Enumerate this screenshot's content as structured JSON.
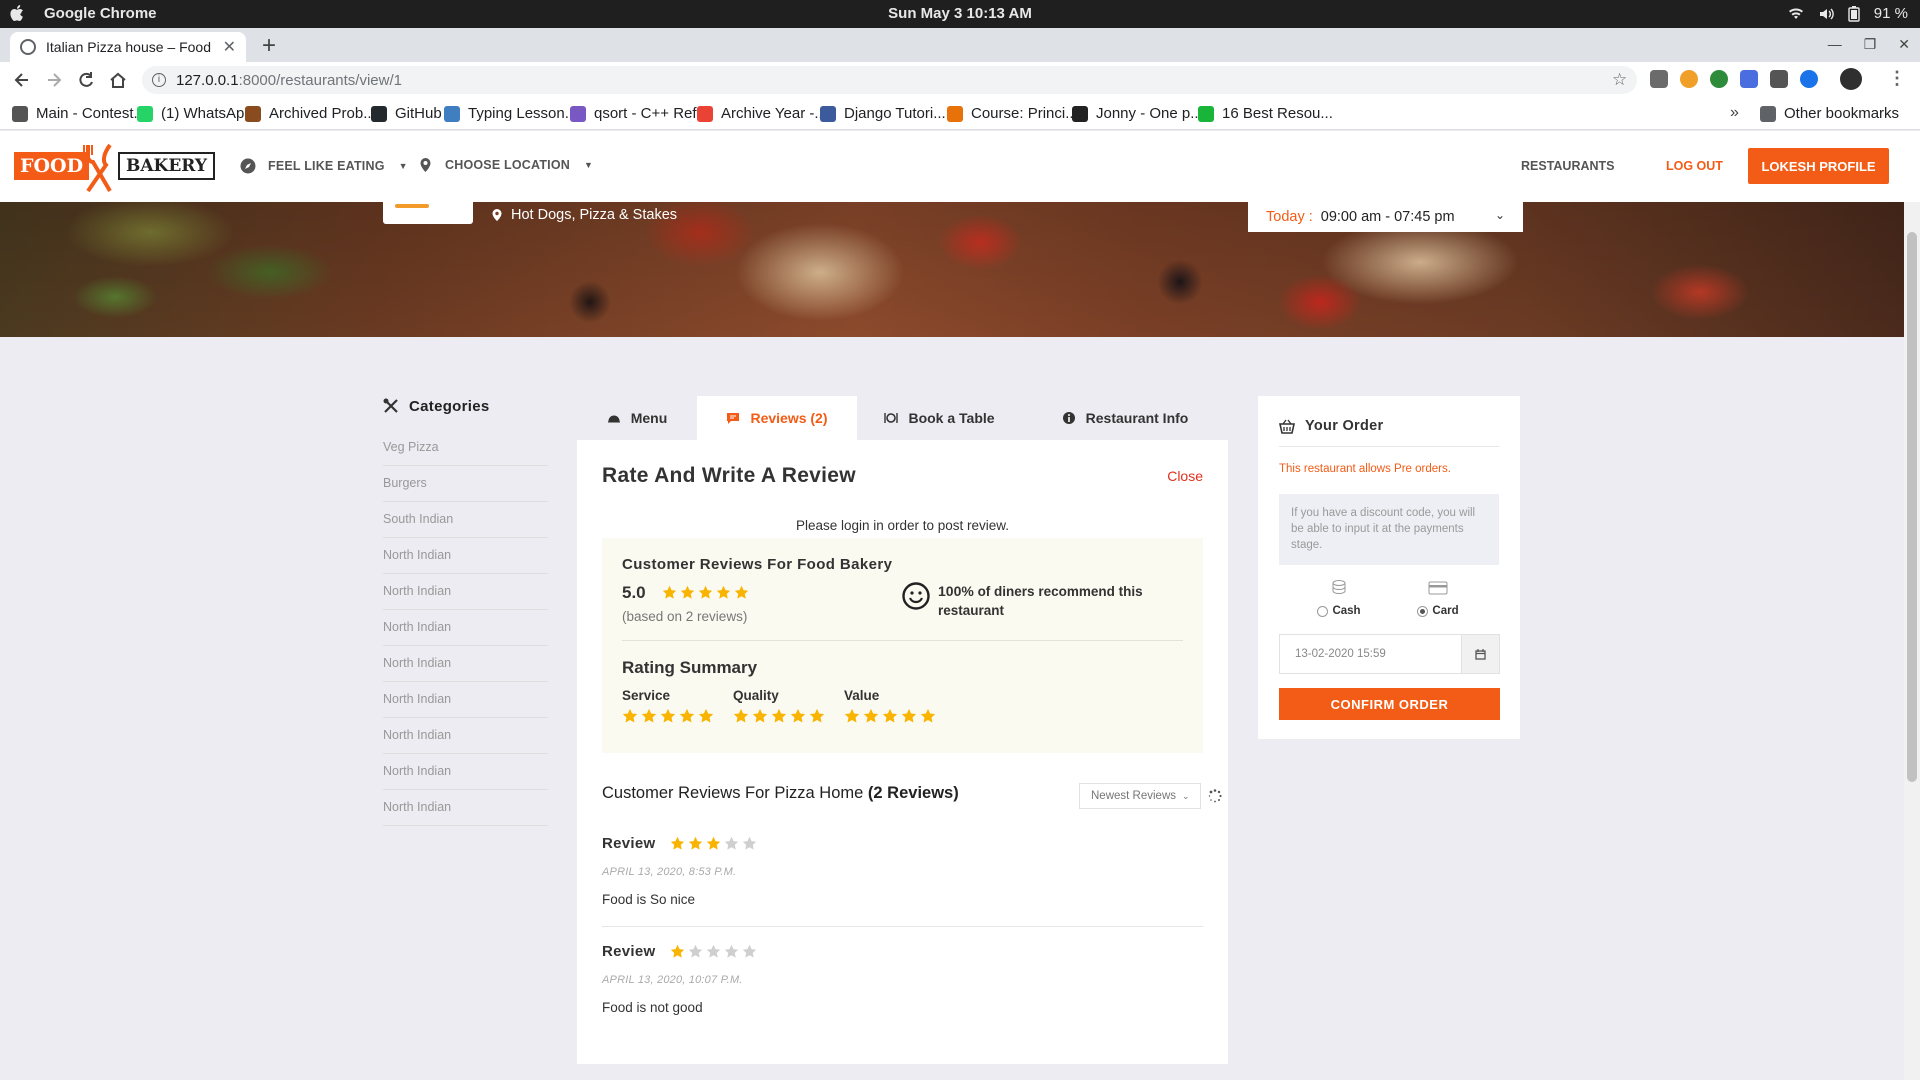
{
  "os": {
    "app_name": "Google Chrome",
    "clock": "Sun May 3  10:13 AM",
    "battery": "91 %"
  },
  "browser": {
    "tab_title": "Italian Pizza house – Food",
    "url_host": "127.0.0.1",
    "url_path": ":8000/restaurants/view/1",
    "bookmarks": [
      {
        "label": "Main - Contest...",
        "color": "#555555"
      },
      {
        "label": "(1) WhatsApp",
        "color": "#25d366"
      },
      {
        "label": "Archived Prob...",
        "color": "#8a4b1f"
      },
      {
        "label": "GitHub",
        "color": "#24292e"
      },
      {
        "label": "Typing Lesson...",
        "color": "#3f7fbf"
      },
      {
        "label": "qsort - C++ Ref...",
        "color": "#7a58c4"
      },
      {
        "label": "Archive Year -...",
        "color": "#ea4335"
      },
      {
        "label": "Django Tutori...",
        "color": "#3b5b9d"
      },
      {
        "label": "Course: Princi...",
        "color": "#e8710a"
      },
      {
        "label": "Jonny - One p...",
        "color": "#222222"
      },
      {
        "label": "16 Best Resou...",
        "color": "#18b53a"
      }
    ],
    "other_bookmarks": "Other bookmarks"
  },
  "header": {
    "logo_food": "FOOD",
    "logo_bakery": "BAKERY",
    "nav_eating": "FEEL LIKE EATING",
    "nav_location": "CHOOSE LOCATION",
    "link_restaurants": "RESTAURANTS",
    "link_logout": "LOG OUT",
    "profile_button": "LOKESH PROFILE",
    "brand_color": "#f25c16"
  },
  "hero": {
    "cuisines": "Hot Dogs, Pizza & Stakes",
    "hours_label": "Today :",
    "hours_value": "09:00 am - 07:45 pm"
  },
  "categories": {
    "title": "Categories",
    "items": [
      "Veg Pizza",
      "Burgers",
      "South Indian",
      "North Indian",
      "North Indian",
      "North Indian",
      "North Indian",
      "North Indian",
      "North Indian",
      "North Indian",
      "North Indian"
    ]
  },
  "tabs": [
    {
      "label": "Menu",
      "active": false
    },
    {
      "label": "Reviews (2)",
      "active": true
    },
    {
      "label": "Book a Table",
      "active": false
    },
    {
      "label": "Restaurant Info",
      "active": false
    }
  ],
  "review_panel": {
    "title": "Rate And Write A Review",
    "close": "Close",
    "login_message": "Please login in order to post review.",
    "summary_title": "Customer Reviews For Food Bakery",
    "score": "5.0",
    "score_stars": 5,
    "based_on": "(based on 2 reviews)",
    "recommend_percent": "100%",
    "recommend_text": " of diners recommend this restaurant",
    "rating_summary_title": "Rating Summary",
    "rating_summary": [
      {
        "label": "Service",
        "stars": 5
      },
      {
        "label": "Quality",
        "stars": 5
      },
      {
        "label": "Value",
        "stars": 5
      }
    ],
    "reviews_heading": "Customer Reviews For Pizza Home",
    "reviews_count": "(2 Reviews)",
    "sort_label": "Newest Reviews",
    "reviews": [
      {
        "title": "Review",
        "stars": 3,
        "date": "APRIL 13, 2020, 8:53 P.M.",
        "text": "Food is So nice"
      },
      {
        "title": "Review",
        "stars": 1,
        "date": "APRIL 13, 2020, 10:07 P.M.",
        "text": "Food is not good"
      }
    ]
  },
  "order": {
    "title": "Your Order",
    "pre_orders": "This restaurant allows Pre orders.",
    "discount_note": "If you have a discount code, you will be able to input it at the payments stage.",
    "pay_cash": "Cash",
    "pay_card": "Card",
    "selected_payment": "Card",
    "datetime": "13-02-2020 15:59",
    "confirm": "CONFIRM ORDER"
  }
}
